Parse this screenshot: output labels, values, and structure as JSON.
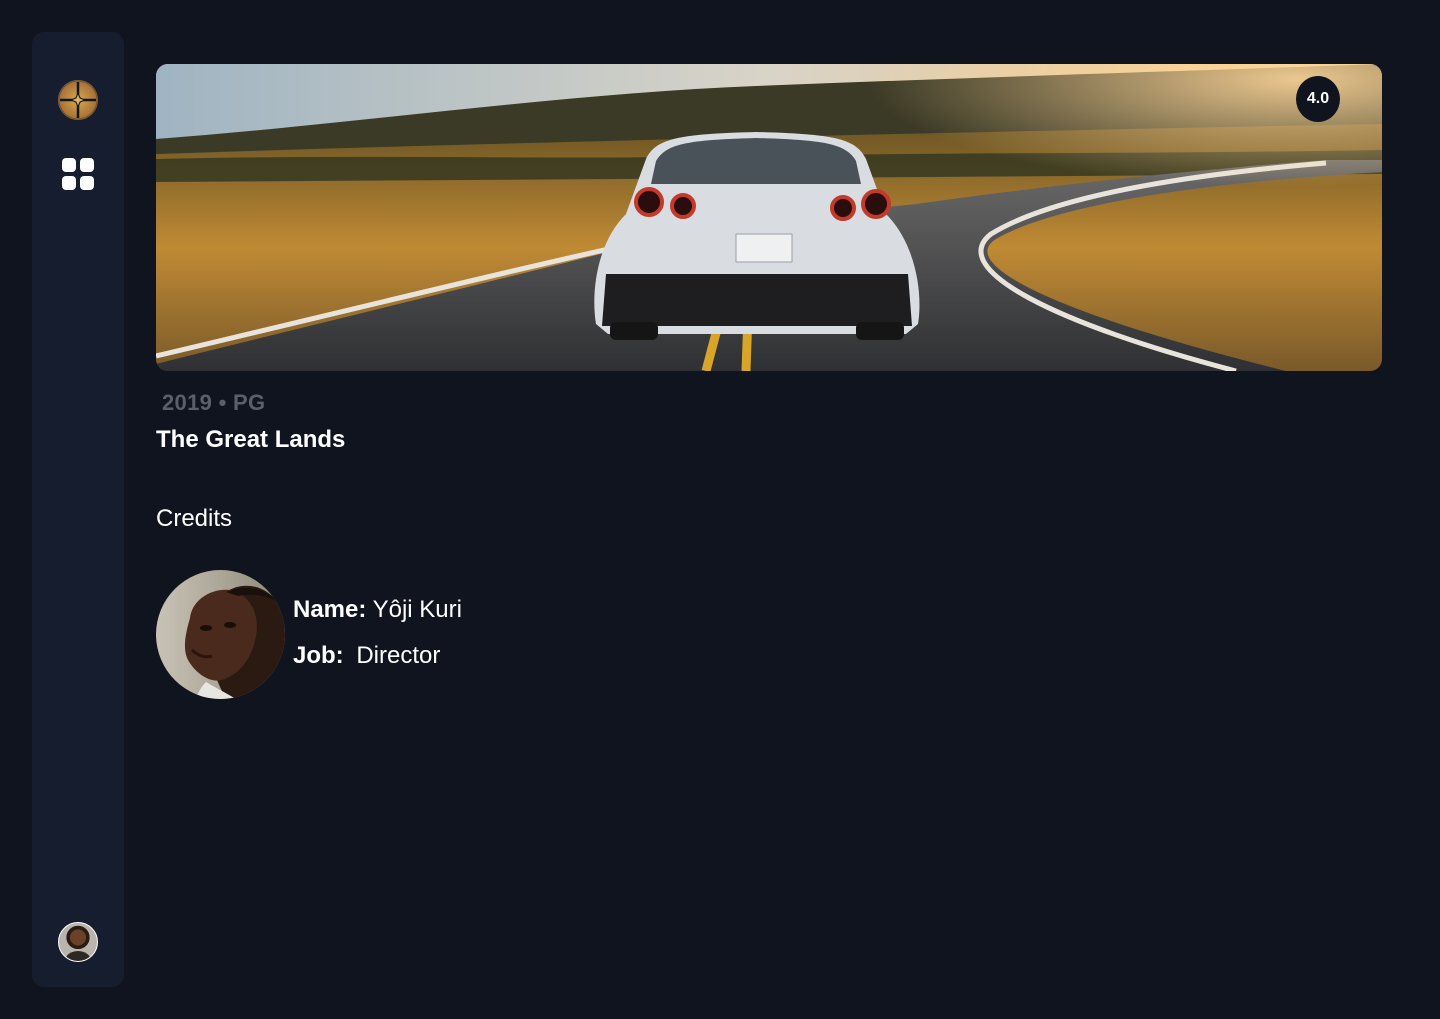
{
  "sidebar": {
    "logo_icon": "compass-star-icon",
    "nav_icon": "grid-icon",
    "profile_icon": "avatar"
  },
  "hero": {
    "image": "sports car on winding road at sunset",
    "rating": "4.0"
  },
  "movie": {
    "year": "2019",
    "separator": "•",
    "rating_label": "PG",
    "title": "The Great Lands"
  },
  "credits": {
    "heading": "Credits",
    "items": [
      {
        "name_label": "Name:",
        "name": "Yôji Kuri",
        "job_label": "Job:",
        "job": "Director"
      }
    ]
  },
  "colors": {
    "background": "#10141f",
    "sidebar": "#161d2f",
    "accent": "#d8a94e",
    "muted_text": "#5a5f6c"
  }
}
